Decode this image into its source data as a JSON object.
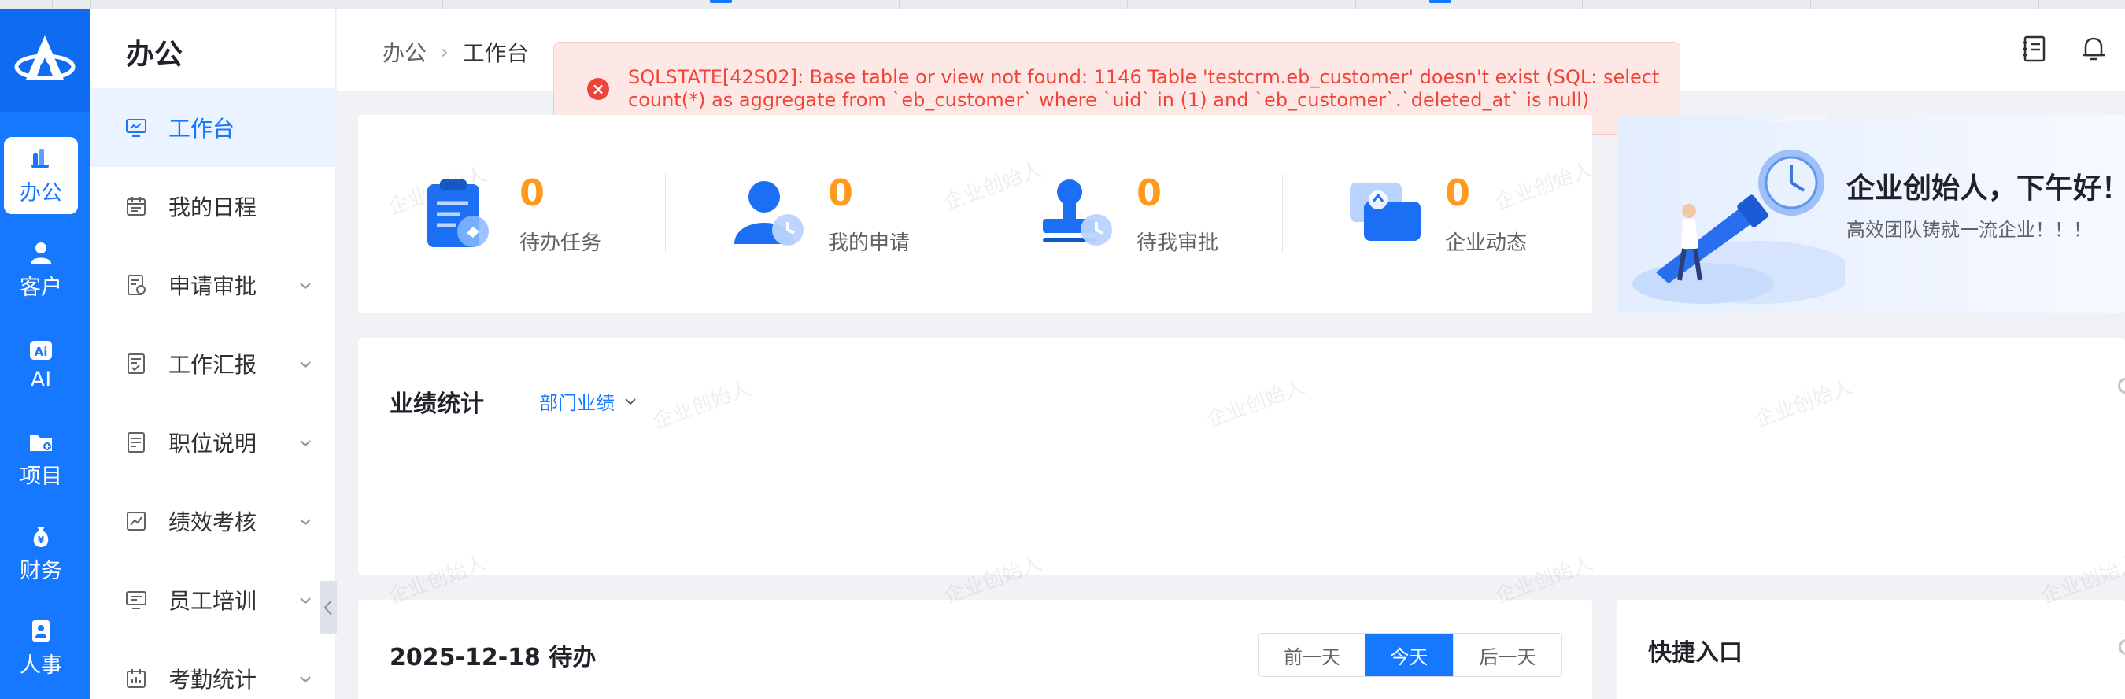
{
  "app": {
    "module_title": "办公"
  },
  "rail": [
    {
      "label": "办公",
      "icon": "office-icon",
      "active": true
    },
    {
      "label": "客户",
      "icon": "customer-icon"
    },
    {
      "label": "AI",
      "icon": "ai-icon"
    },
    {
      "label": "项目",
      "icon": "project-folder-icon"
    },
    {
      "label": "财务",
      "icon": "money-bag-icon"
    },
    {
      "label": "人事",
      "icon": "badge-icon"
    }
  ],
  "subnav": [
    {
      "label": "工作台",
      "icon": "monitor-icon",
      "active": true
    },
    {
      "label": "我的日程",
      "icon": "calendar-icon"
    },
    {
      "label": "申请审批",
      "icon": "approval-icon",
      "expandable": true
    },
    {
      "label": "工作汇报",
      "icon": "report-icon",
      "expandable": true
    },
    {
      "label": "职位说明",
      "icon": "document-icon",
      "expandable": true
    },
    {
      "label": "绩效考核",
      "icon": "chart-icon",
      "expandable": true
    },
    {
      "label": "员工培训",
      "icon": "training-icon",
      "expandable": true
    },
    {
      "label": "考勤统计",
      "icon": "attendance-icon",
      "expandable": true
    }
  ],
  "breadcrumb": {
    "parent": "办公",
    "current": "工作台"
  },
  "error": {
    "message": "SQLSTATE[42S02]: Base table or view not found: 1146 Table 'testcrm.eb_customer' doesn't exist (SQL: select count(*) as aggregate from `eb_customer` where `uid` in (1) and `eb_customer`.`deleted_at` is null)"
  },
  "stats": [
    {
      "value": "0",
      "label": "待办任务",
      "icon": "clipboard-icon"
    },
    {
      "value": "0",
      "label": "我的申请",
      "icon": "user-clock-icon"
    },
    {
      "value": "0",
      "label": "待我审批",
      "icon": "stamp-icon"
    },
    {
      "value": "0",
      "label": "企业动态",
      "icon": "chat-icon"
    }
  ],
  "banner": {
    "greeting": "企业创始人，下午好！",
    "slogan": "高效团队铸就一流企业！！！"
  },
  "performance": {
    "title": "业绩统计",
    "scope": "部门业绩"
  },
  "todo": {
    "title": "2025-12-18 待办",
    "prev": "前一天",
    "today": "今天",
    "next": "后一天"
  },
  "quick": {
    "title": "快捷入口"
  },
  "watermark": "企业创始人",
  "colors": {
    "primary": "#1677ff",
    "stat_number": "#ff9a1f",
    "error": "#f04438"
  }
}
